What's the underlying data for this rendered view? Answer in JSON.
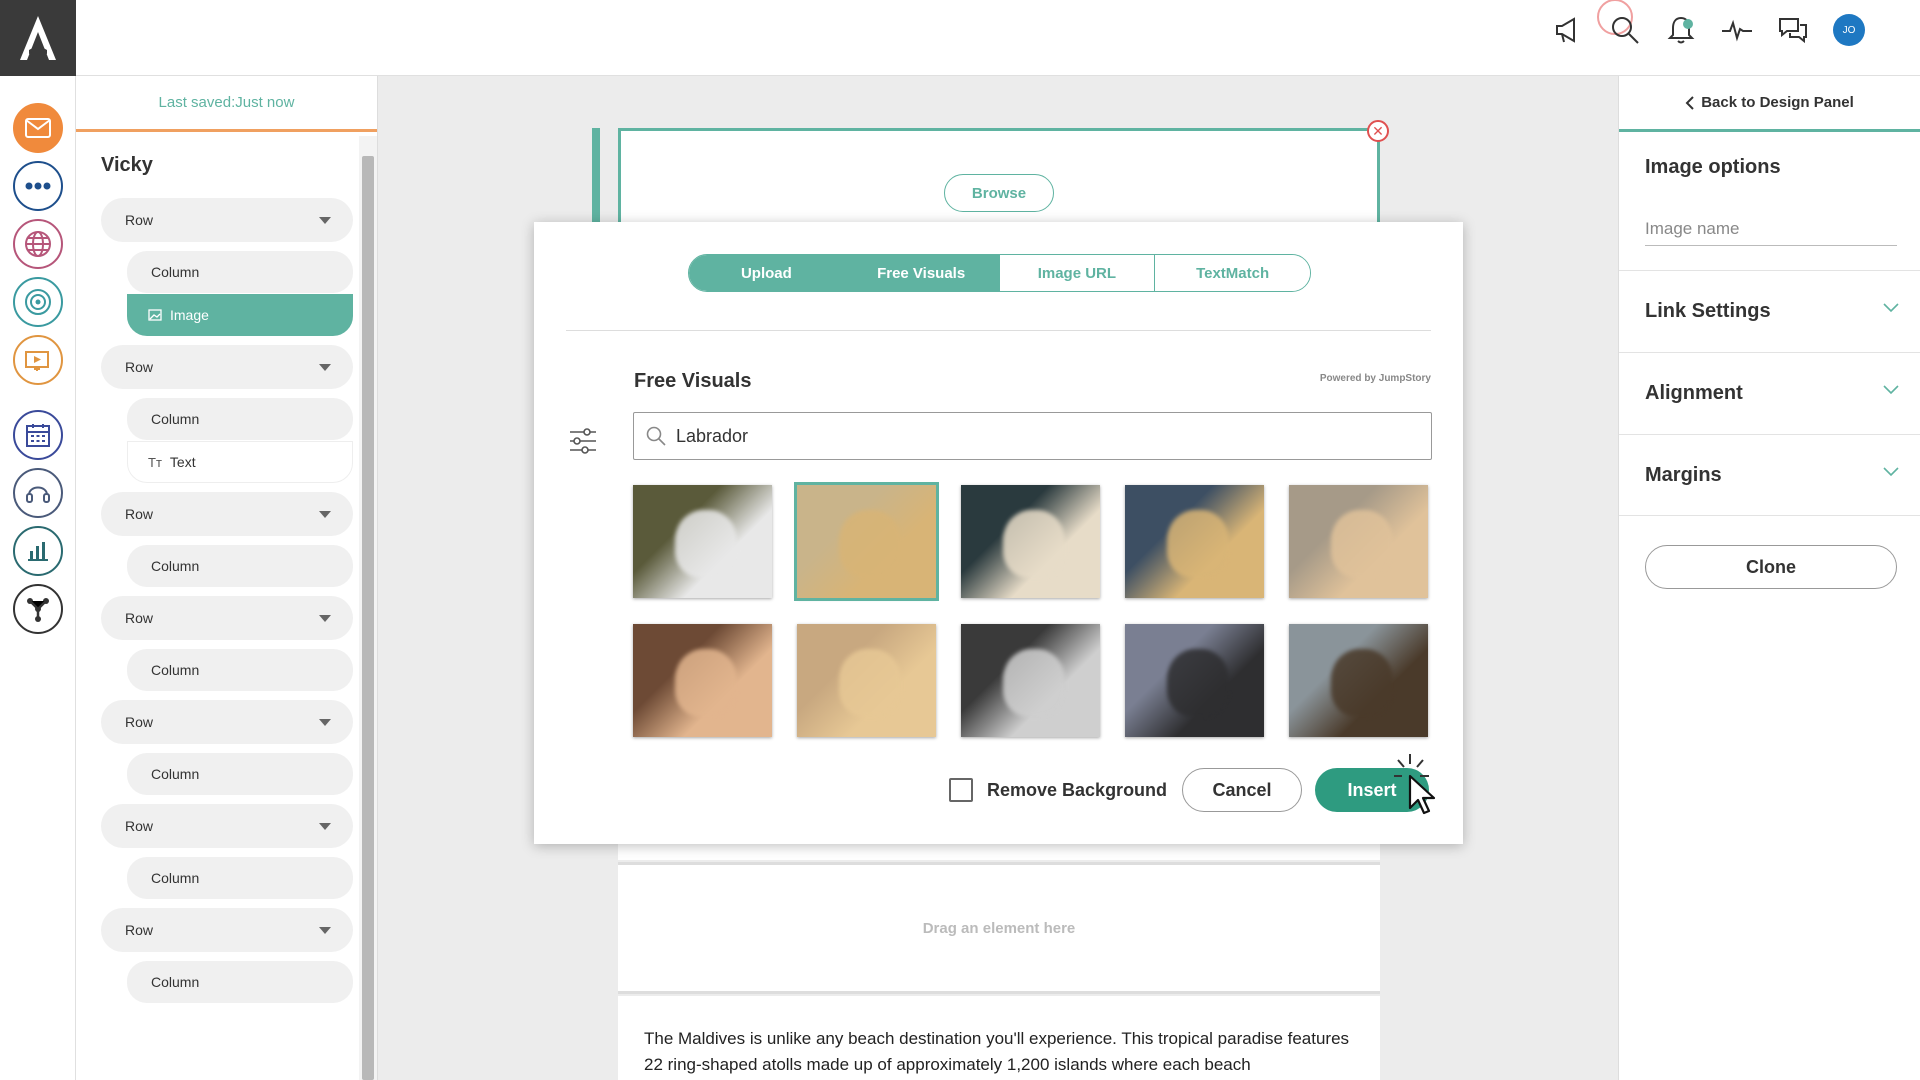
{
  "header": {
    "logo_letter": "A",
    "avatar_initials": "JO"
  },
  "outline": {
    "last_saved": "Last saved:Just now",
    "title": "Vicky",
    "items": [
      {
        "type": "row",
        "label": "Row"
      },
      {
        "type": "column",
        "label": "Column"
      },
      {
        "type": "child",
        "label": "Image",
        "icon": "image-icon",
        "selected": true
      },
      {
        "type": "row",
        "label": "Row"
      },
      {
        "type": "column",
        "label": "Column"
      },
      {
        "type": "child",
        "label": "Text",
        "icon": "text-icon",
        "selected": false
      },
      {
        "type": "row",
        "label": "Row"
      },
      {
        "type": "column",
        "label": "Column"
      },
      {
        "type": "row",
        "label": "Row"
      },
      {
        "type": "column",
        "label": "Column"
      },
      {
        "type": "row",
        "label": "Row"
      },
      {
        "type": "column",
        "label": "Column"
      },
      {
        "type": "row",
        "label": "Row"
      },
      {
        "type": "column",
        "label": "Column"
      },
      {
        "type": "row",
        "label": "Row"
      },
      {
        "type": "column",
        "label": "Column"
      }
    ]
  },
  "canvas": {
    "browse_label": "Browse",
    "drag_hint": "Drag an element here",
    "body_text": "The Maldives is unlike any beach destination you'll experience. This tropical paradise features 22 ring-shaped atolls made up of approximately 1,200 islands where each beach"
  },
  "modal": {
    "tabs": [
      {
        "label": "Upload",
        "active": true
      },
      {
        "label": "Free Visuals",
        "active": true
      },
      {
        "label": "Image URL",
        "active": false
      },
      {
        "label": "TextMatch",
        "active": false
      }
    ],
    "title": "Free Visuals",
    "powered_by": "Powered by JumpStory",
    "search_value": "Labrador",
    "images": [
      {
        "name": "white labrador puppy in grass",
        "colors": [
          "#5a5a3a",
          "#e8e8e8"
        ],
        "selected": false
      },
      {
        "name": "labrador lying on floor",
        "colors": [
          "#c9b48a",
          "#d8b476"
        ],
        "selected": true
      },
      {
        "name": "yellow labrador close-up",
        "colors": [
          "#2a3a3e",
          "#e7dcc8"
        ],
        "selected": false
      },
      {
        "name": "labrador in doorway",
        "colors": [
          "#3d4f63",
          "#d9b576"
        ],
        "selected": false
      },
      {
        "name": "labrador on beach",
        "colors": [
          "#a69a88",
          "#e0c29a"
        ],
        "selected": false
      },
      {
        "name": "puppy resting head",
        "colors": [
          "#6d4a35",
          "#e2b58e"
        ],
        "selected": false
      },
      {
        "name": "yellow lab puppy",
        "colors": [
          "#c8a880",
          "#e7c895"
        ],
        "selected": false
      },
      {
        "name": "black and white dogs sleeping",
        "colors": [
          "#3a3a3a",
          "#cfcfcf"
        ],
        "selected": false
      },
      {
        "name": "black labrador portrait",
        "colors": [
          "#7a7f92",
          "#2e2e30"
        ],
        "selected": false
      },
      {
        "name": "chocolate lab in water",
        "colors": [
          "#8a949a",
          "#4a3a2a"
        ],
        "selected": false
      }
    ],
    "remove_background_label": "Remove Background",
    "cancel_label": "Cancel",
    "insert_label": "Insert"
  },
  "right_panel": {
    "back_label": "Back to Design Panel",
    "title": "Image options",
    "image_name_placeholder": "Image name",
    "sections": [
      "Link Settings",
      "Alignment",
      "Margins"
    ],
    "clone_label": "Clone"
  },
  "colors": {
    "accent": "#5fb3a1",
    "insert": "#2e9b80",
    "saved_border": "#f0a060",
    "avatar": "#1e78c2"
  }
}
